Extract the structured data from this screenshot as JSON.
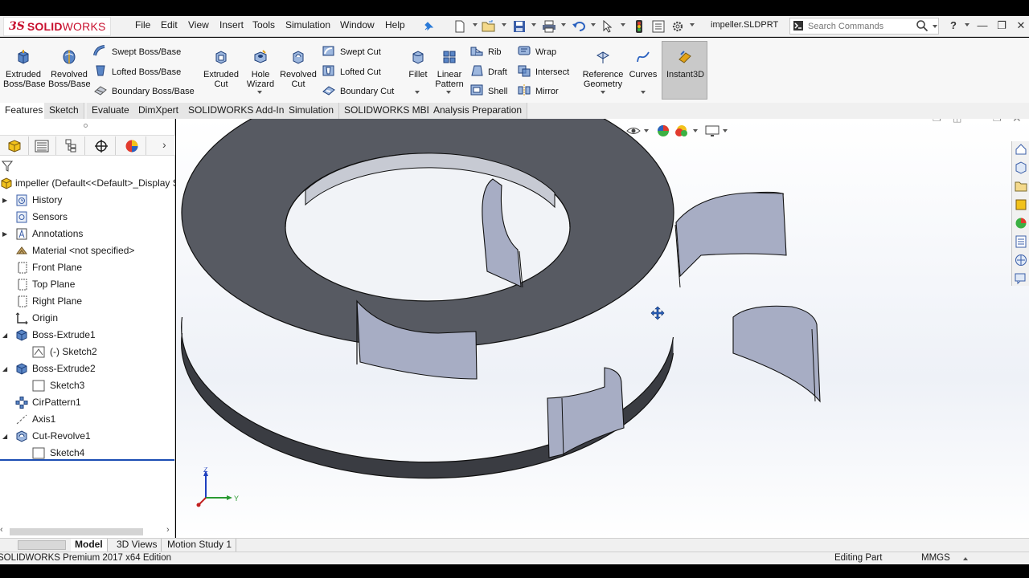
{
  "app": {
    "brand_prefix": "3S",
    "brand_bold": "SOLID",
    "brand_rest": "WORKS",
    "document_name": "impeller.SLDPRT"
  },
  "menu": [
    "File",
    "Edit",
    "View",
    "Insert",
    "Tools",
    "Simulation",
    "Window",
    "Help"
  ],
  "search": {
    "placeholder": "Search Commands"
  },
  "ribbon": {
    "extruded_boss": [
      "Extruded",
      "Boss/Base"
    ],
    "revolved_boss": [
      "Revolved",
      "Boss/Base"
    ],
    "swept_boss": "Swept Boss/Base",
    "lofted_boss": "Lofted Boss/Base",
    "boundary_boss": "Boundary Boss/Base",
    "extruded_cut": [
      "Extruded",
      "Cut"
    ],
    "hole_wizard": [
      "Hole",
      "Wizard"
    ],
    "revolved_cut": [
      "Revolved",
      "Cut"
    ],
    "swept_cut": "Swept Cut",
    "lofted_cut": "Lofted Cut",
    "boundary_cut": "Boundary Cut",
    "fillet": "Fillet",
    "linear_pattern": [
      "Linear",
      "Pattern"
    ],
    "rib": "Rib",
    "draft": "Draft",
    "shell": "Shell",
    "wrap": "Wrap",
    "intersect": "Intersect",
    "mirror": "Mirror",
    "reference_geometry": [
      "Reference",
      "Geometry"
    ],
    "curves": "Curves",
    "instant3d": "Instant3D"
  },
  "tabs": [
    "Features",
    "Sketch",
    "Evaluate",
    "DimXpert",
    "SOLIDWORKS Add-Ins",
    "Simulation",
    "SOLIDWORKS MBD",
    "Analysis Preparation"
  ],
  "active_tab": "Features",
  "tree": {
    "root": "impeller  (Default<<Default>_Display St",
    "items": [
      {
        "label": "History",
        "icon": "history-icon",
        "expandable": true
      },
      {
        "label": "Sensors",
        "icon": "sensors-icon",
        "expandable": false
      },
      {
        "label": "Annotations",
        "icon": "annotations-icon",
        "expandable": true
      },
      {
        "label": "Material <not specified>",
        "icon": "material-icon",
        "expandable": false
      },
      {
        "label": "Front Plane",
        "icon": "plane-icon",
        "expandable": false
      },
      {
        "label": "Top Plane",
        "icon": "plane-icon",
        "expandable": false
      },
      {
        "label": "Right Plane",
        "icon": "plane-icon",
        "expandable": false
      },
      {
        "label": "Origin",
        "icon": "origin-icon",
        "expandable": false
      },
      {
        "label": "Boss-Extrude1",
        "icon": "extrude-feature-icon",
        "expandable": true,
        "expanded": true
      },
      {
        "label": "(-) Sketch2",
        "icon": "sketch-icon",
        "child": true
      },
      {
        "label": "Boss-Extrude2",
        "icon": "extrude-feature-icon",
        "expandable": true,
        "expanded": true
      },
      {
        "label": "Sketch3",
        "icon": "sketch-icon",
        "child": true
      },
      {
        "label": "CirPattern1",
        "icon": "circular-pattern-icon",
        "expandable": false
      },
      {
        "label": "Axis1",
        "icon": "axis-icon",
        "expandable": false
      },
      {
        "label": "Cut-Revolve1",
        "icon": "revolve-cut-feature-icon",
        "expandable": true,
        "expanded": true
      },
      {
        "label": "Sketch4",
        "icon": "sketch-icon",
        "child": true
      }
    ]
  },
  "triad": {
    "z": "Z",
    "y": "Y"
  },
  "bottom_tabs": [
    "Model",
    "3D Views",
    "Motion Study 1"
  ],
  "active_bottom_tab": "Model",
  "status": {
    "edition": "SOLIDWORKS Premium 2017 x64 Edition",
    "mode": "Editing Part",
    "units": "MMGS"
  },
  "colors": {
    "brand": "#c8102e",
    "part_face": "#575a62",
    "blade": "#a7adc4",
    "selection_line": "#1b4db3"
  }
}
